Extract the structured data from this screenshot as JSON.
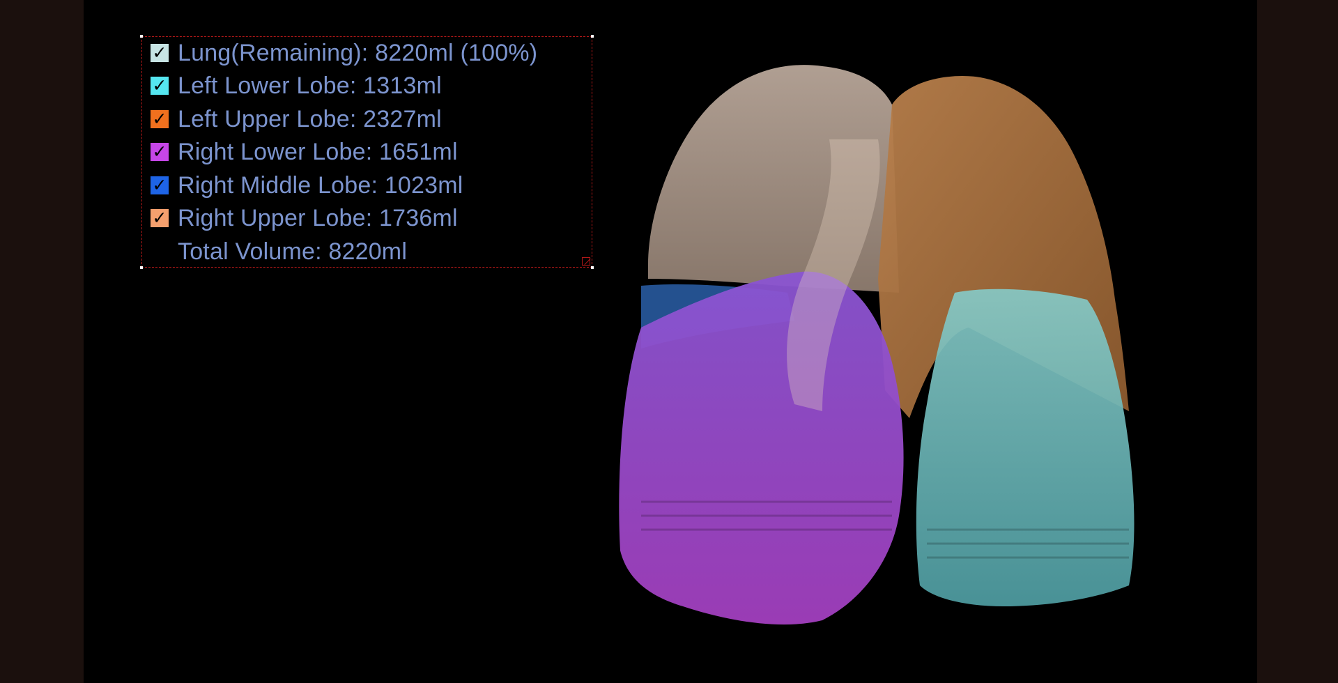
{
  "legend": {
    "items": [
      {
        "label": "Lung(Remaining): 8220ml (100%)",
        "color": "#c7e4e4",
        "checked": true
      },
      {
        "label": "Left Lower Lobe: 1313ml",
        "color": "#55e6f0",
        "checked": true
      },
      {
        "label": "Left Upper Lobe: 2327ml",
        "color": "#f0701e",
        "checked": true
      },
      {
        "label": "Right Lower Lobe: 1651ml",
        "color": "#c646e8",
        "checked": true
      },
      {
        "label": "Right Middle Lobe: 1023ml",
        "color": "#1e64e6",
        "checked": true
      },
      {
        "label": "Right Upper Lobe: 1736ml",
        "color": "#f5a06e",
        "checked": true
      }
    ],
    "total": "Total Volume: 8220ml",
    "check_glyph": "✓"
  },
  "colors": {
    "text": "#7c94ce",
    "frame": "#b01818",
    "background": "#000000"
  },
  "icons": {
    "checkbox": "checkbox-icon",
    "resize": "resize-handle-icon"
  }
}
